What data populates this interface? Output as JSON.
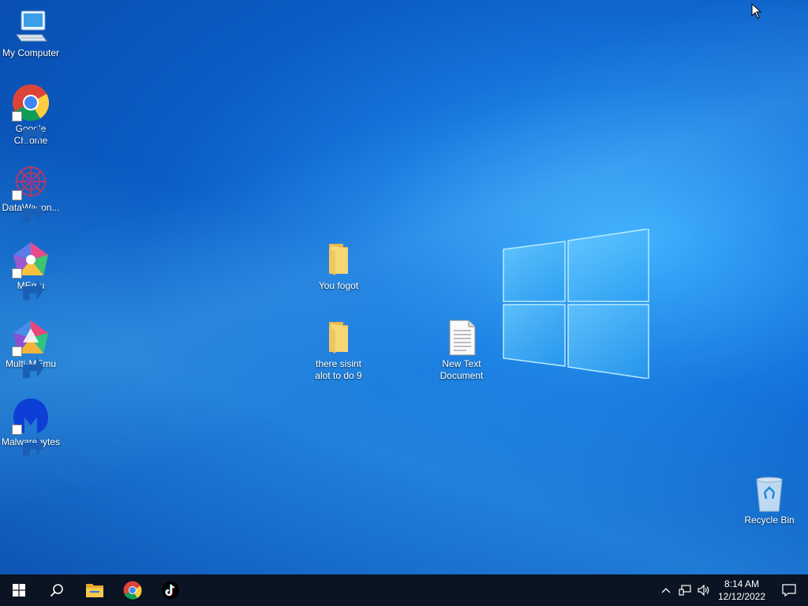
{
  "desktop": {
    "icons": [
      {
        "label": "My Computer",
        "icon": "computer-icon"
      },
      {
        "label": "Google\nChrome",
        "icon": "chrome-icon"
      },
      {
        "label": "DataWagon...",
        "icon": "datawagon-icon"
      },
      {
        "label": "MEmu",
        "icon": "memu-icon"
      },
      {
        "label": "Multi-MEmu",
        "icon": "multi-memu-icon"
      },
      {
        "label": "Malwarebytes",
        "icon": "malwarebytes-icon"
      },
      {
        "label": "You fogot",
        "icon": "folder-icon"
      },
      {
        "label": "there sisint\nalot to do 9",
        "icon": "folder-icon"
      },
      {
        "label": "New Text\nDocument",
        "icon": "text-document-icon"
      },
      {
        "label": "Recycle Bin",
        "icon": "recycle-bin-icon"
      }
    ]
  },
  "taskbar": {
    "pinned": [
      "start-icon",
      "search-icon",
      "file-explorer-icon",
      "chrome-icon",
      "tiktok-icon"
    ],
    "tray": {
      "time": "8:14 AM",
      "date": "12/12/2022"
    }
  },
  "colors": {
    "taskbar_bg": "#0b1422",
    "wallpaper_accent": "#1678de"
  }
}
